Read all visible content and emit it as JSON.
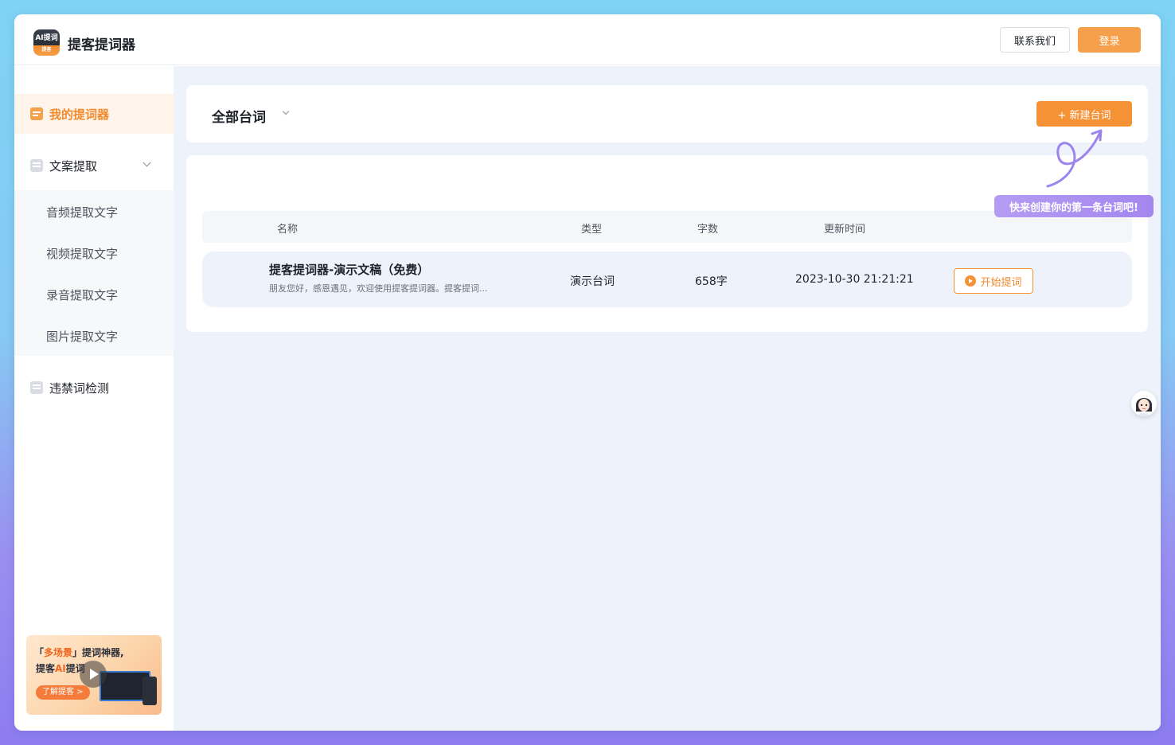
{
  "app": {
    "logo_line1": "AI提词",
    "logo_line2": "提客",
    "title": "提客提词器"
  },
  "header": {
    "contact_label": "联系我们",
    "login_label": "登录"
  },
  "sidebar": {
    "items": [
      {
        "label": "我的提词器",
        "active": true,
        "icon": "document-icon"
      },
      {
        "label": "文案提取",
        "expanded": true,
        "icon": "file-icon"
      },
      {
        "label": "违禁词检测",
        "icon": "shield-check-icon"
      }
    ],
    "sub_items": [
      "音频提取文字",
      "视频提取文字",
      "录音提取文字",
      "图片提取文字"
    ],
    "promo": {
      "line1_quote_open": "「",
      "line1_highlight": "多场景",
      "line1_quote_close": "」",
      "line1_rest": "提词神器,",
      "line2_prefix": "提客",
      "line2_highlight": "AI",
      "line2_suffix": "提词",
      "cta": "了解提客 >"
    }
  },
  "main": {
    "filter_title": "全部台词",
    "new_button": "+ 新建台词",
    "tooltip": "快来创建你的第一条台词吧!",
    "table": {
      "headers": [
        "名称",
        "类型",
        "字数",
        "更新时间"
      ],
      "rows": [
        {
          "name": "提客提词器-演示文稿（免费）",
          "desc": "朋友您好，感恩遇见，欢迎使用提客提词器。提客提词...",
          "type": "演示台词",
          "count": "658字",
          "updated": "2023-10-30 21:21:21",
          "action": "开始提词"
        }
      ]
    }
  },
  "colors": {
    "accent": "#f59236",
    "tooltip": "#a486ee",
    "main_bg": "#eef3fb"
  }
}
